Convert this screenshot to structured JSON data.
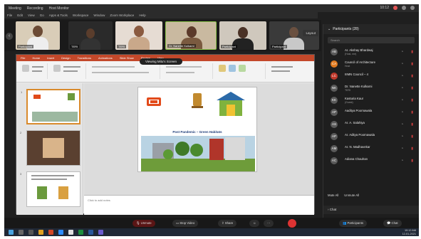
{
  "titlebar": {
    "items": [
      "Meeting",
      "Recording",
      "Host Monitor"
    ],
    "time": "10:12"
  },
  "menubar": {
    "items": [
      "File",
      "Edit",
      "View",
      "Go",
      "Apps & Tools",
      "Workspace",
      "Window",
      "Zoom Workplace",
      "Help"
    ]
  },
  "video_strip": {
    "tiles": [
      {
        "name": "Participant"
      },
      {
        "name": "TERI"
      },
      {
        "name": "TERI"
      },
      {
        "name": "Dr. Nanette Kulkarni"
      },
      {
        "name": "Participant"
      },
      {
        "name": "Participant"
      }
    ],
    "layout_label": "Layout"
  },
  "share_banner": "Viewing Mitu's Screen",
  "powerpoint": {
    "tabs": [
      "File",
      "Home",
      "Insert",
      "Design",
      "Transitions",
      "Animations",
      "Slide Show",
      "Review",
      "View"
    ],
    "slide_title": "Post Pandemic – Green Habitats",
    "notes_placeholder": "Click to add notes",
    "thumb_numbers": [
      "1",
      "2",
      "3"
    ]
  },
  "participants": {
    "header": "Participants (28)",
    "search_placeholder": "Search",
    "list": [
      {
        "initials": "AB",
        "name": "Ar. Akshay Bhardwaj",
        "sub": "(Host, me)"
      },
      {
        "initials": "CA",
        "name": "Council of Architecture",
        "sub": "Host"
      },
      {
        "initials": "LC",
        "name": "IIIMN Council – 4",
        "sub": ""
      },
      {
        "initials": "NK",
        "name": "Dr. Nanette Kulkarni",
        "sub": "TERI"
      },
      {
        "initials": "KK",
        "name": "Kasturia Kaur",
        "sub": "(Guest)"
      },
      {
        "initials": "AP",
        "name": "Aaditya Poornawala",
        "sub": ""
      },
      {
        "initials": "AS",
        "name": "Ar. A. Salahiya",
        "sub": ""
      },
      {
        "initials": "AP",
        "name": "Ar. Aditya Poornawala",
        "sub": ""
      },
      {
        "initials": "AM",
        "name": "Ar. N. Madhavekar",
        "sub": ""
      },
      {
        "initials": "AC",
        "name": "Adiana Chauhan",
        "sub": ""
      }
    ],
    "mute_all": "Mute All",
    "more": "Unmute All",
    "chat_label": "Chat"
  },
  "controls": {
    "unmute": "Unmute",
    "stop_video": "Stop Video",
    "share": "Share",
    "participants": "Participants",
    "chat": "Chat"
  },
  "taskbar": {
    "time": "10:12 AM",
    "date": "12-01-2021"
  }
}
